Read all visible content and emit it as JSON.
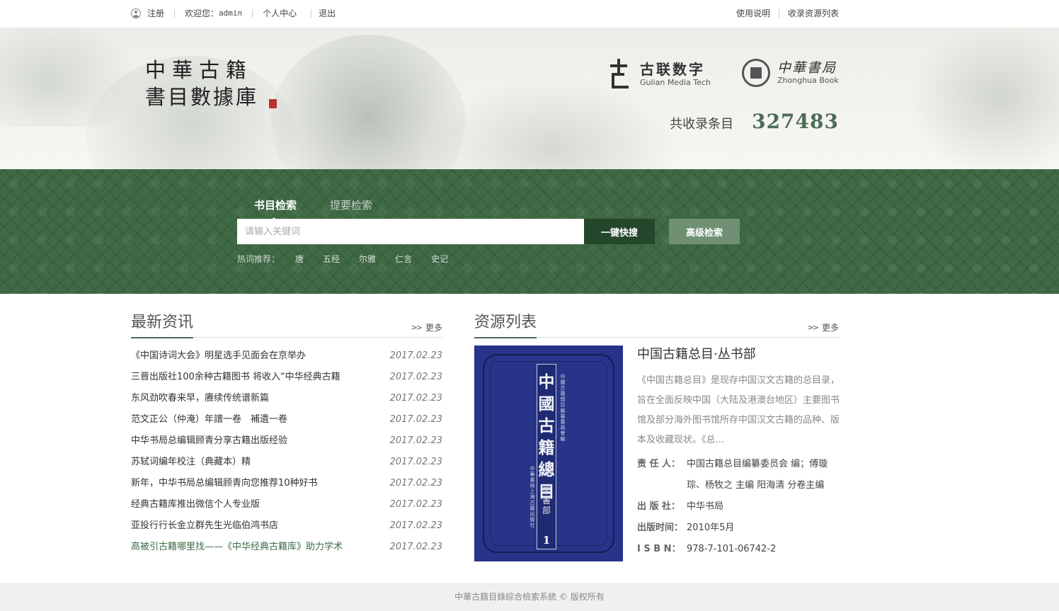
{
  "topbar": {
    "register": "注册",
    "welcome": "欢迎您：",
    "username": "admin",
    "personal_center": "个人中心",
    "logout": "退出",
    "help": "使用说明",
    "resource_list": "收录资源列表"
  },
  "banner": {
    "title_line1": "中華古籍",
    "title_line2": "書目數據庫",
    "gulian_name": "古联数字",
    "gulian_en": "Gulian Media Tech",
    "zhonghua_name": "中華書局",
    "zhonghua_en": "Zhonghua Book",
    "total_label": "共收录条目",
    "total_count": "327483"
  },
  "search": {
    "tabs": [
      {
        "label": "书目检索",
        "active": true
      },
      {
        "label": "提要检索",
        "active": false
      }
    ],
    "placeholder": "请输入关键词",
    "quick_button": "一键快搜",
    "advanced_button": "高级检索",
    "hot_label": "热词推荐：",
    "hot_words": [
      "唐",
      "五经",
      "尔雅",
      "仁言",
      "史记"
    ]
  },
  "news": {
    "title": "最新资讯",
    "more": "更多",
    "items": [
      {
        "title": "《中国诗词大会》明星选手见面会在京举办",
        "date": "2017.02.23"
      },
      {
        "title": "三晋出版社100余种古籍图书 将收入“中华经典古籍",
        "date": "2017.02.23"
      },
      {
        "title": "东风劲吹春来早，赓续传统谱新篇",
        "date": "2017.02.23"
      },
      {
        "title": "范文正公（仲淹）年譜一卷　補遺一卷",
        "date": "2017.02.23"
      },
      {
        "title": "中华书局总编辑顾青分享古籍出版经验",
        "date": "2017.02.23"
      },
      {
        "title": "苏轼词编年校注（典藏本）精",
        "date": "2017.02.23"
      },
      {
        "title": "新年，中华书局总编辑顾青向您推荐10种好书",
        "date": "2017.02.23"
      },
      {
        "title": "经典古籍库推出微信个人专业版",
        "date": "2017.02.23"
      },
      {
        "title": "亚投行行长金立群先生光临伯鸿书店",
        "date": "2017.02.23"
      },
      {
        "title": "高被引古籍哪里找——《中华经典古籍库》助力学术",
        "date": "2017.02.23"
      }
    ]
  },
  "resources": {
    "title": "资源列表",
    "more": "更多",
    "book": {
      "cover_title": "中國古籍總目",
      "cover_subtitle": "叢書部",
      "cover_volume": "1",
      "cover_editor": "中國古籍總目編纂委員會編",
      "cover_publishers": "中華書局 上海古籍出版社",
      "title": "中国古籍总目·丛书部",
      "description": "《中国古籍总目》是现存中国汉文古籍的总目录，旨在全面反映中国（大陆及港澳台地区）主要图书馆及部分海外图书馆所存中国汉文古籍的品种、版本及收藏现状。《总...",
      "meta": [
        {
          "key": "责 任 人：",
          "value": "中国古籍总目编纂委员会 编；傅璇琮、杨牧之 主编 阳海清 分卷主编"
        },
        {
          "key": "出 版 社：",
          "value": "中华书局"
        },
        {
          "key": "出版时间：",
          "value": "2010年5月"
        },
        {
          "key": "I S B N：",
          "value": "978-7-101-06742-2"
        }
      ]
    }
  },
  "footer": {
    "text": "中華古籍目錄綜合檢索系統 © 版权所有"
  },
  "colors": {
    "brand_green": "#3f6a45",
    "dark_green": "#24462a",
    "light_green": "#6f9073",
    "accent_total": "#4e6b55"
  }
}
